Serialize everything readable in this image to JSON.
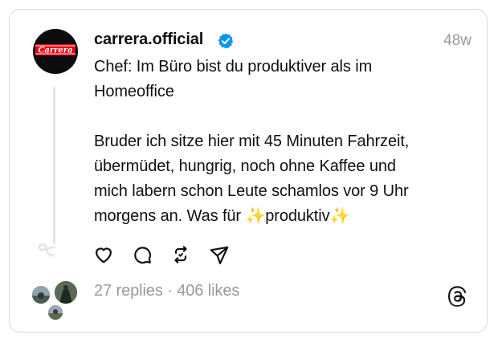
{
  "post": {
    "username": "carrera.official",
    "timestamp": "48w",
    "avatar_logo_text": "Carrera",
    "text_lines_1": [
      "Chef: Im Büro bist du produktiver als im",
      "Homeoffice"
    ],
    "text_lines_2": [
      "Bruder ich sitze hier mit 45 Minuten Fahrzeit,",
      "übermüdet, hungrig, noch ohne Kaffee und",
      "mich labern schon Leute schamlos vor 9 Uhr",
      "morgens an. Was für ✨produktiv✨"
    ]
  },
  "stats": {
    "replies": "27 replies",
    "separator": " · ",
    "likes": "406 likes"
  },
  "icons": {
    "like": "heart-icon",
    "reply": "comment-icon",
    "repost": "repost-icon",
    "share": "send-icon",
    "verified": "verified-badge-icon",
    "threads": "threads-logo-icon"
  },
  "colors": {
    "text": "#101010",
    "muted": "#999999",
    "verified": "#0095f6",
    "border": "#d9d9d9",
    "avatar_bg": "#0c0c0c",
    "logo_red": "#e30613"
  }
}
